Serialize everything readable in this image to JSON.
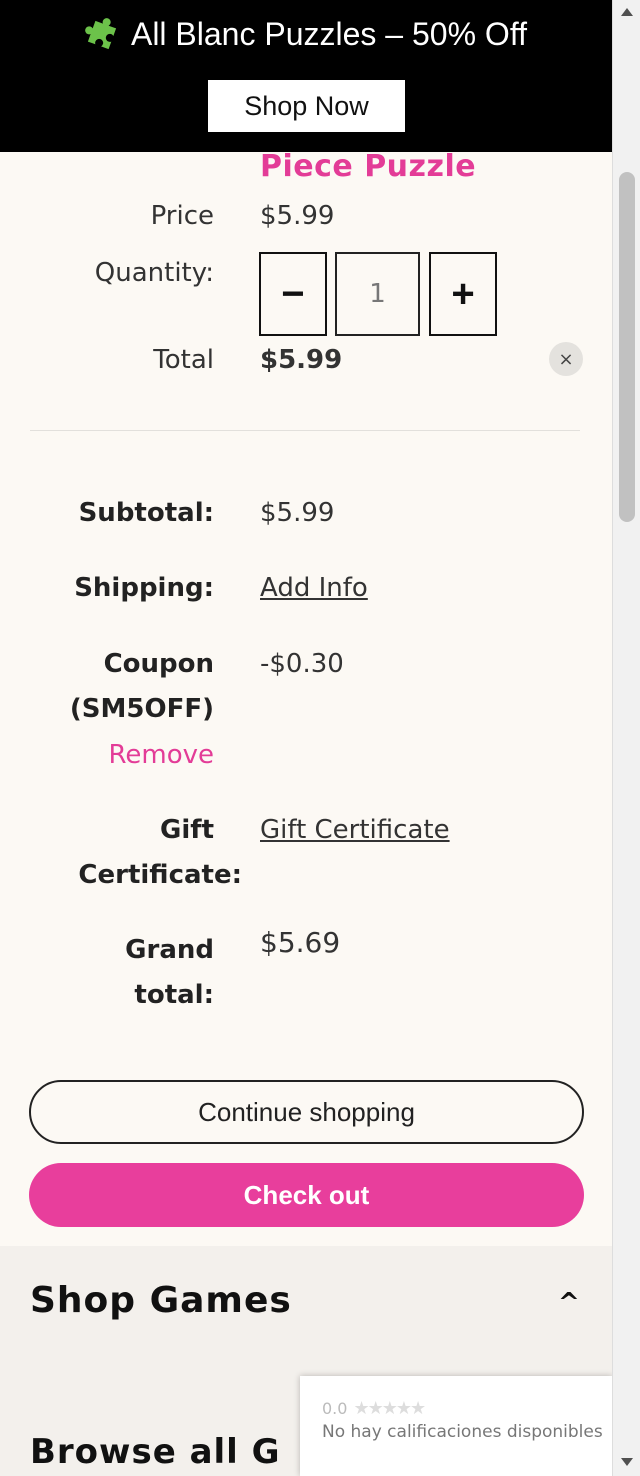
{
  "banner": {
    "title": "All Blanc Puzzles – 50% Off",
    "icon": "puzzle-piece-icon",
    "cta_label": "Shop Now"
  },
  "cart_item": {
    "name_partial": "Piece Puzzle",
    "price_label": "Price",
    "price_value": "$5.99",
    "quantity_label": "Quantity:",
    "quantity_value": "1",
    "minus_symbol": "−",
    "plus_symbol": "+",
    "total_label": "Total",
    "total_value": "$5.99",
    "remove_icon": "×"
  },
  "summary": {
    "subtotal_label": "Subtotal:",
    "subtotal_value": "$5.99",
    "shipping_label": "Shipping:",
    "shipping_value": "Add Info",
    "coupon_label_line1": "Coupon",
    "coupon_label_line2": "(SM5OFF)",
    "coupon_value": "-$0.30",
    "coupon_remove": "Remove",
    "gift_label_line1": "Gift",
    "gift_label_line2": "Certificate:",
    "gift_value": "Gift Certificate",
    "grand_label_line1": "Grand",
    "grand_label_line2": "total:",
    "grand_value": "$5.69"
  },
  "actions": {
    "continue_label": "Continue shopping",
    "checkout_label": "Check out"
  },
  "footer": {
    "shop_games_heading": "Shop Games",
    "caret": "^",
    "browse_partial": "Browse all G"
  },
  "rating_widget": {
    "score": "0.0",
    "stars": "★★★★★",
    "message": "No hay calificaciones disponibles"
  },
  "colors": {
    "brand_pink": "#e33c97",
    "checkout_pink": "#e83e9c",
    "banner_bg": "#000000",
    "page_bg": "#fcf9f4"
  }
}
